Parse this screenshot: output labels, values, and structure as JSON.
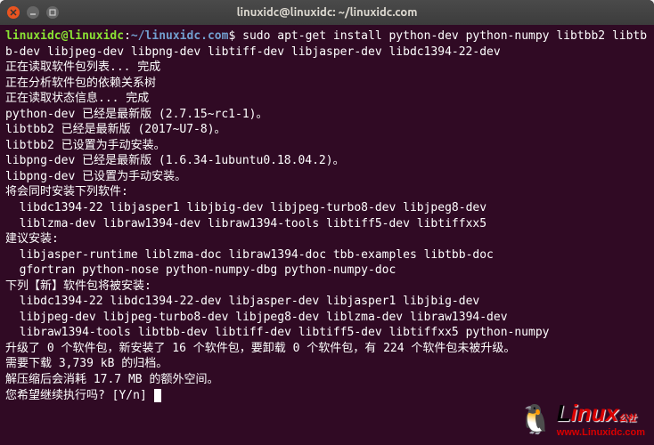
{
  "window": {
    "title": "linuxidc@linuxidc: ~/linuxidc.com"
  },
  "prompt": {
    "user_host": "linuxidc@linuxidc",
    "colon": ":",
    "path": "~/linuxidc.com",
    "symbol": "$"
  },
  "command": "sudo apt-get install python-dev python-numpy libtbb2 libtbb-dev libjpeg-dev libpng-dev libtiff-dev libjasper-dev libdc1394-22-dev",
  "lines": [
    "正在读取软件包列表... 完成",
    "正在分析软件包的依赖关系树",
    "正在读取状态信息... 完成",
    "python-dev 已经是最新版 (2.7.15~rc1-1)。",
    "libtbb2 已经是最新版 (2017~U7-8)。",
    "libtbb2 已设置为手动安装。",
    "libpng-dev 已经是最新版 (1.6.34-1ubuntu0.18.04.2)。",
    "libpng-dev 已设置为手动安装。",
    "将会同时安装下列软件:",
    "  libdc1394-22 libjasper1 libjbig-dev libjpeg-turbo8-dev libjpeg8-dev",
    "  liblzma-dev libraw1394-dev libraw1394-tools libtiff5-dev libtiffxx5",
    "建议安装:",
    "  libjasper-runtime liblzma-doc libraw1394-doc tbb-examples libtbb-doc",
    "  gfortran python-nose python-numpy-dbg python-numpy-doc",
    "下列【新】软件包将被安装:",
    "  libdc1394-22 libdc1394-22-dev libjasper-dev libjasper1 libjbig-dev",
    "  libjpeg-dev libjpeg-turbo8-dev libjpeg8-dev liblzma-dev libraw1394-dev",
    "  libraw1394-tools libtbb-dev libtiff-dev libtiff5-dev libtiffxx5 python-numpy",
    "升级了 0 个软件包，新安装了 16 个软件包，要卸载 0 个软件包，有 224 个软件包未被升级。",
    "需要下载 3,739 kB 的归档。",
    "解压缩后会消耗 17.7 MB 的额外空间。",
    "您希望继续执行吗? [Y/n] "
  ],
  "watermark": {
    "brand_prefix": "L",
    "brand_rest": "inux",
    "brand_suffix": "公社",
    "url": "www.Linuxidc.com",
    "penguin": "🐧"
  }
}
